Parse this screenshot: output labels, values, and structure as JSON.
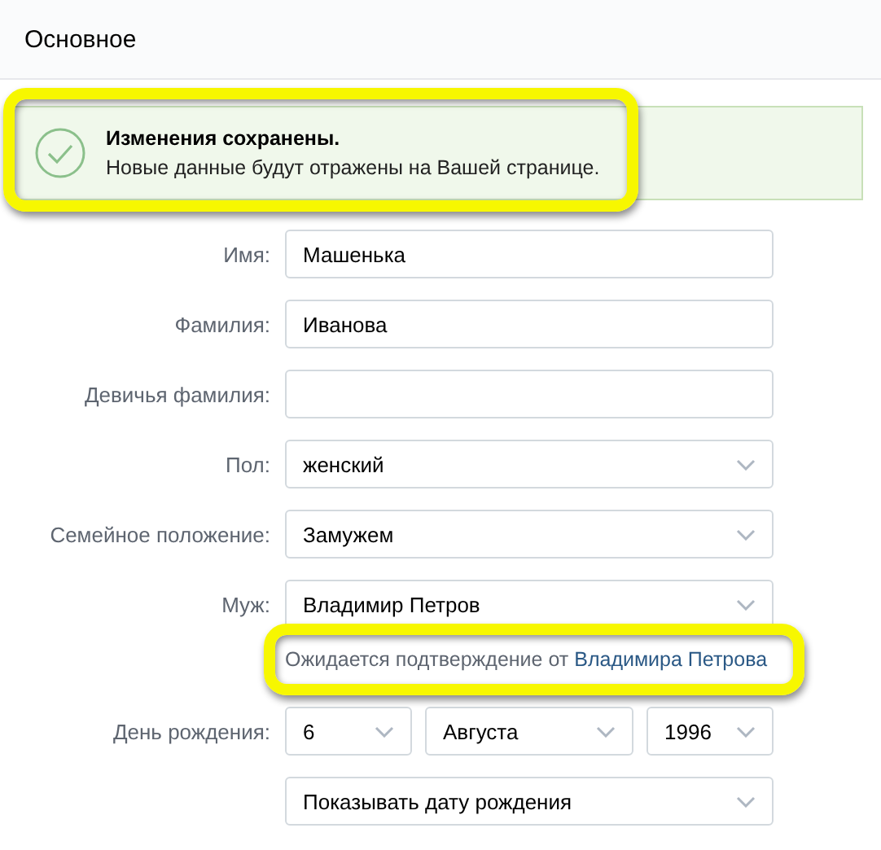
{
  "header": {
    "title": "Основное"
  },
  "alert": {
    "title": "Изменения сохранены.",
    "message": "Новые данные будут отражены на Вашей странице.",
    "highlighted": true
  },
  "fields": [
    {
      "label": "Имя:",
      "kind": "input",
      "value": "Машенька"
    },
    {
      "label": "Фамилия:",
      "kind": "input",
      "value": "Иванова"
    },
    {
      "label": "Девичья фамилия:",
      "kind": "input"
    },
    {
      "label": "Пол:",
      "kind": "select",
      "value": "женский"
    },
    {
      "label": "Семейное положение:",
      "kind": "select",
      "value": "Замужем"
    },
    {
      "label": "Муж:",
      "kind": "select",
      "value": "Владимир Петров"
    }
  ],
  "pending": {
    "text": "Ожидается подтверждение от",
    "link": "Владимира Петрова",
    "highlighted": true
  },
  "birthday": {
    "label": "День рождения:",
    "day": "6",
    "month": "Августа",
    "year": "1996"
  },
  "birthday_visibility": {
    "value": "Показывать дату рождения"
  }
}
